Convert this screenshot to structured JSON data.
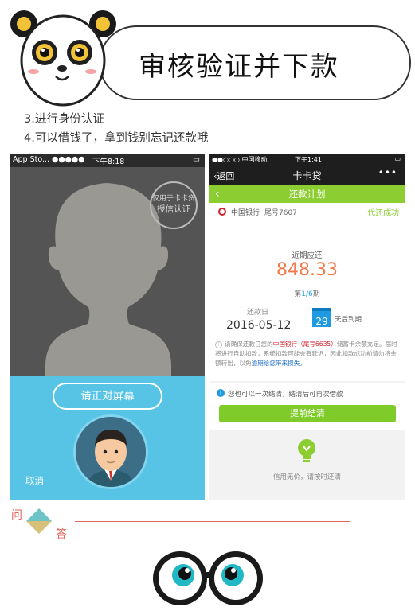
{
  "header": {
    "title": "审核验证并下款"
  },
  "steps": [
    "3.进行身份认证",
    "4.可以借钱了，拿到钱别忘记还款哦"
  ],
  "left_phone": {
    "status_app": "App Sto... ●●●●● ",
    "status_time": "下午8:18",
    "stamp_line1": "仅用于卡卡贷",
    "stamp_line2": "授信认证",
    "face_button": "请正对屏幕",
    "cancel": "取消"
  },
  "right_phone": {
    "status_carrier": "●●○○○ 中国移动 ",
    "status_time": "下午1:41",
    "back": "返回",
    "nav_title": "卡卡贷",
    "more": "•••",
    "plan_title": "还款计划",
    "bank_name": "中国银行",
    "bank_tail": "尾号7607",
    "status": "代还成功",
    "due_label": "近期应还",
    "amount": "848.33",
    "period_pre": "第",
    "period_cur": "1/6",
    "period_post": "期",
    "repay_label": "还款日",
    "repay_date": "2016-05-12",
    "days_left": "29",
    "days_note": "天后到期",
    "notice_1": "请确保还款日您的",
    "notice_bank": "中国银行（尾号6635）",
    "notice_2": "储蓄卡余额充足。届时将进行自动扣款，系统扣款可能会有延迟，因此扣款成功前请勿将余额转出，以免",
    "notice_warn": "逾期给您带来损失。",
    "info": "您也可以一次结清，结清后可再次借款",
    "settle_button": "提前结清",
    "slogan": "信用无价，请按时还清"
  },
  "qa": {
    "q": "问",
    "a": "答"
  },
  "colors": {
    "green": "#8ccd32",
    "blue_panel": "#57c4e5",
    "amount": "#f07a4a",
    "qa_red": "#e0665e"
  }
}
